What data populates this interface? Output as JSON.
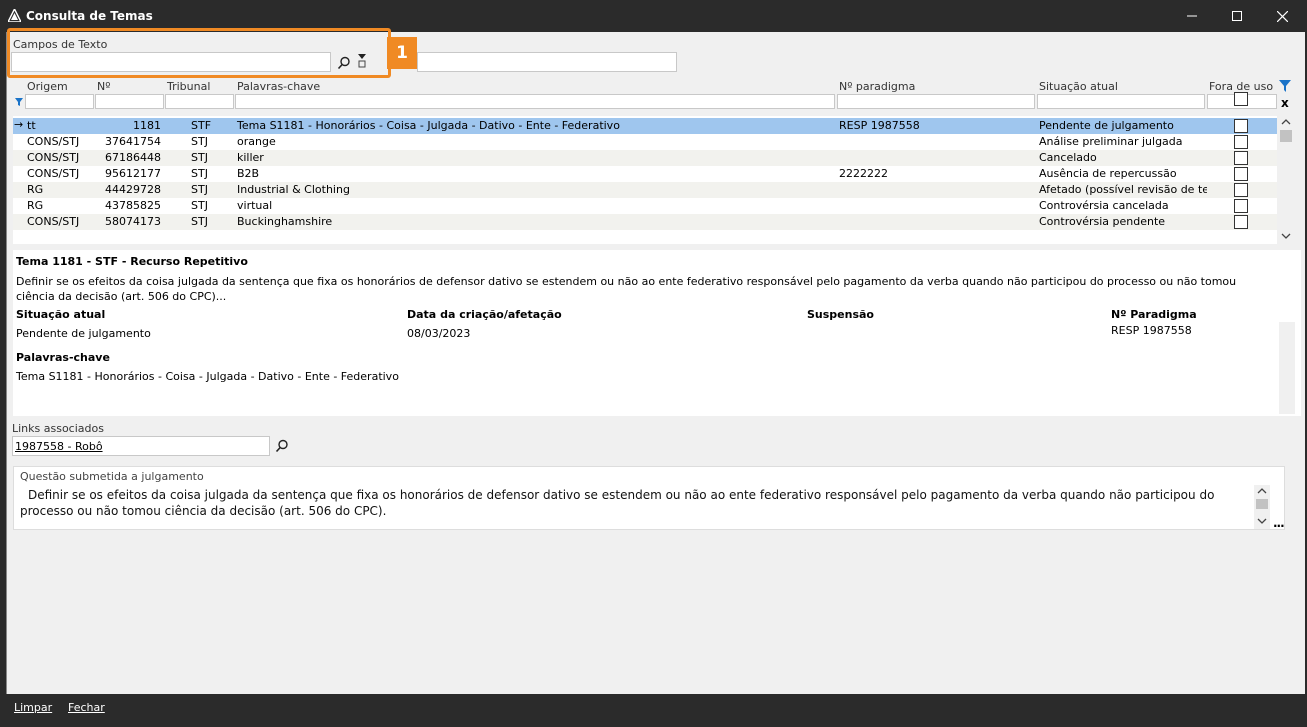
{
  "window": {
    "title": "Consulta de Temas"
  },
  "search": {
    "label": "Campos de Texto",
    "value": "",
    "badge": "1"
  },
  "grid": {
    "columns": [
      "Origem",
      "Nº",
      "Tribunal",
      "Palavras-chave",
      "Nº paradigma",
      "Situação atual",
      "Fora de uso"
    ],
    "rows": [
      {
        "origem": "tt",
        "numero": "1181",
        "tribunal": "STF",
        "palavras": "Tema S1181 - Honorários - Coisa - Julgada - Dativo - Ente - Federativo",
        "paradigma": "RESP 1987558",
        "situacao": "Pendente de julgamento"
      },
      {
        "origem": "CONS/STJ",
        "numero": "37641754",
        "tribunal": "STJ",
        "palavras": "orange",
        "paradigma": "",
        "situacao": "Análise preliminar julgada"
      },
      {
        "origem": "CONS/STJ",
        "numero": "67186448",
        "tribunal": "STJ",
        "palavras": "killer",
        "paradigma": "",
        "situacao": "Cancelado"
      },
      {
        "origem": "CONS/STJ",
        "numero": "95612177",
        "tribunal": "STJ",
        "palavras": "B2B",
        "paradigma": "2222222",
        "situacao": "Ausência de repercussão"
      },
      {
        "origem": "RG",
        "numero": "44429728",
        "tribunal": "STJ",
        "palavras": "Industrial & Clothing",
        "paradigma": "",
        "situacao": "Afetado (possível revisão de tese)"
      },
      {
        "origem": "RG",
        "numero": "43785825",
        "tribunal": "STJ",
        "palavras": "virtual",
        "paradigma": "",
        "situacao": "Controvérsia cancelada"
      },
      {
        "origem": "CONS/STJ",
        "numero": "58074173",
        "tribunal": "STJ",
        "palavras": "Buckinghamshire",
        "paradigma": "",
        "situacao": "Controvérsia pendente"
      }
    ],
    "filter_clear": "x"
  },
  "details": {
    "header": "Tema 1181 - STF - Recurso Repetitivo",
    "description": "Definir se os efeitos da coisa julgada da sentença que fixa os honorários de defensor dativo se estendem ou não ao ente federativo responsável pelo pagamento da verba quando não participou do processo ou não tomou ciência da decisão (art. 506 do CPC)...",
    "situacao_label": "Situação atual",
    "situacao_value": "Pendente de julgamento",
    "data_label": "Data da criação/afetação",
    "data_value": "08/03/2023",
    "suspensao_label": "Suspensão",
    "paradigma_label": "Nº Paradigma",
    "paradigma_value": "RESP 1987558",
    "palavras_label": "Palavras-chave",
    "palavras_value": "Tema S1181 - Honorários - Coisa - Julgada - Dativo - Ente - Federativo"
  },
  "links": {
    "label": "Links associados",
    "value": "1987558 - Robô"
  },
  "questao": {
    "label": "Questão submetida a julgamento",
    "text": "Definir se os efeitos da coisa julgada da sentença que fixa os honorários de defensor dativo se estendem ou não ao ente federativo responsável pelo pagamento da verba quando não participou do processo ou não tomou ciência da decisão (art. 506 do CPC).",
    "more": "..."
  },
  "footer": {
    "limpar": "Limpar",
    "fechar": "Fechar"
  }
}
